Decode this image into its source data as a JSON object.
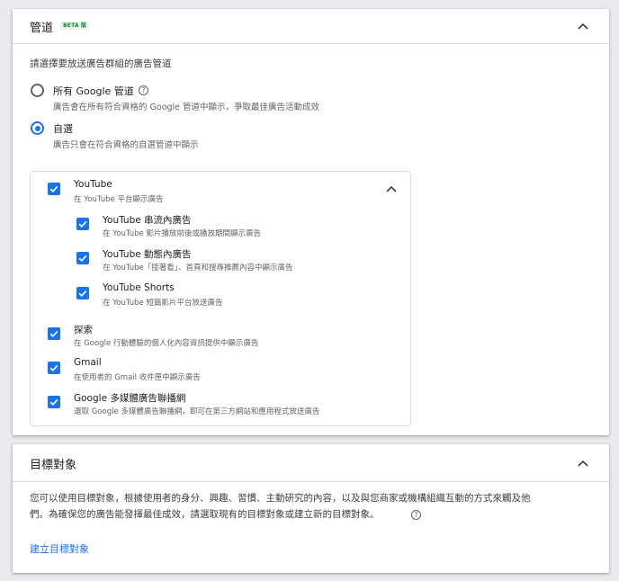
{
  "channels": {
    "title": "管道",
    "badge": "BETA 版",
    "intro": "請選擇要放送廣告群組的廣告管道",
    "options": [
      {
        "label": "所有 Google 管道",
        "desc": "廣告會在所有符合資格的 Google 管道中顯示，爭取最佳廣告活動成效",
        "selected": false
      },
      {
        "label": "自選",
        "desc": "廣告只會在符合資格的自選管道中顯示",
        "selected": true
      }
    ],
    "youtube": {
      "label": "YouTube",
      "desc": "在 YouTube 平台顯示廣告",
      "children": [
        {
          "label": "YouTube 串流內廣告",
          "desc": "在 YouTube 影片播放前後或播放期間顯示廣告"
        },
        {
          "label": "YouTube 動態內廣告",
          "desc": "在 YouTube「接著看」、首頁和搜尋推薦內容中顯示廣告"
        },
        {
          "label": "YouTube Shorts",
          "desc": "在 YouTube 短篇影片平台放送廣告"
        }
      ]
    },
    "others": [
      {
        "label": "探索",
        "desc": "在 Google 行動體驗的個人化內容資訊提供中顯示廣告"
      },
      {
        "label": "Gmail",
        "desc": "在使用者的 Gmail 收件匣中顯示廣告"
      },
      {
        "label": "Google 多媒體廣告聯播網",
        "desc": "選取 Google 多媒體廣告聯播網，即可在第三方網站和應用程式放送廣告"
      }
    ]
  },
  "audience": {
    "title": "目標對象",
    "line1": "您可以使用目標對象，根據使用者的身分、興趣、習慣、主動研究的內容，以及與您商家或機構組織互動的方式來觸及他",
    "line2": "們。為確保您的廣告能發揮最佳成效，請選取現有的目標對象或建立新的目標對象。",
    "create_link": "建立目標對象"
  },
  "help_glyph": "?",
  "colors": {
    "accent": "#1a73e8",
    "beta_bg": "#e6f4ea",
    "beta_text": "#188038"
  }
}
